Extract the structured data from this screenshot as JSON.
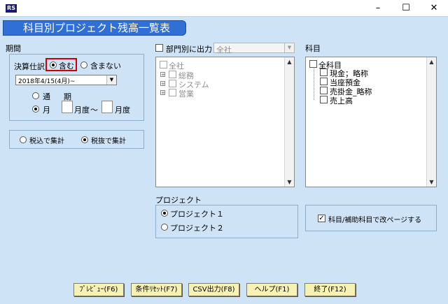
{
  "window": {
    "minimize": "–",
    "maximize": "☐",
    "close": "✕",
    "app_icon": "app-icon"
  },
  "header": {
    "title": "科目別プロジェクト残高一覧表"
  },
  "period": {
    "label": "期間",
    "kessan_label": "決算仕訳",
    "include_label": "含む",
    "exclude_label": "含まない",
    "date_value": "2018年4/15(4月)~",
    "tsuki_label": "通",
    "ki_label": "期",
    "month_label": "月",
    "month_from_unit": "月度",
    "tilde": "～",
    "month_to_unit": "月度"
  },
  "tax": {
    "included_label": "税込で集計",
    "excluded_label": "税抜で集計"
  },
  "department": {
    "check_label": "部門別に出力",
    "combo_value": "全社",
    "tree_root": "全社",
    "tree_items": [
      "総務",
      "システム",
      "営業"
    ]
  },
  "subjects": {
    "label": "科目",
    "tree_root": "全科目",
    "tree_items": [
      "現金；略称",
      "当座預金",
      "売掛金_略称",
      "売上高"
    ]
  },
  "project": {
    "label": "プロジェクト",
    "option1": "プロジェクト１",
    "option2": "プロジェクト２"
  },
  "page_break": {
    "label": "科目/補助科目で改ページする",
    "checked_mark": "✓"
  },
  "buttons": {
    "preview": "ﾌﾟﾚﾋﾞｭｰ(F6)",
    "reset": "条件ﾘｾｯﾄ(F7)",
    "csv": "CSV出力(F8)",
    "help": "ヘルプ(F1)",
    "exit": "終了(F12)"
  },
  "scroll": {
    "up": "▲",
    "down": "▼"
  }
}
